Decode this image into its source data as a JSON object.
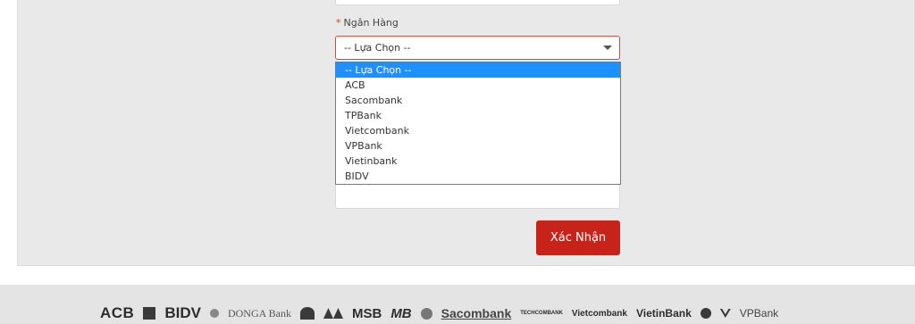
{
  "form": {
    "bank_label": "Ngân Hàng",
    "required_mark": "*",
    "selected_value": "-- Lựa Chọn --",
    "options": [
      "-- Lựa Chọn --",
      "ACB",
      "Sacombank",
      "TPBank",
      "Vietcombank",
      "VPBank",
      "Vietinbank",
      "BIDV"
    ],
    "submit_label": "Xác Nhận"
  },
  "footer": {
    "logos": [
      "ACB",
      "BIDV",
      "DONGA Bank",
      "MSB",
      "MB",
      "Sacombank",
      "TECHCOMBANK",
      "Vietcombank",
      "VietinBank",
      "VPBank"
    ]
  },
  "colors": {
    "accent": "#c8231b",
    "selected_option": "#1e90ff",
    "panel": "#e9e9e9"
  }
}
